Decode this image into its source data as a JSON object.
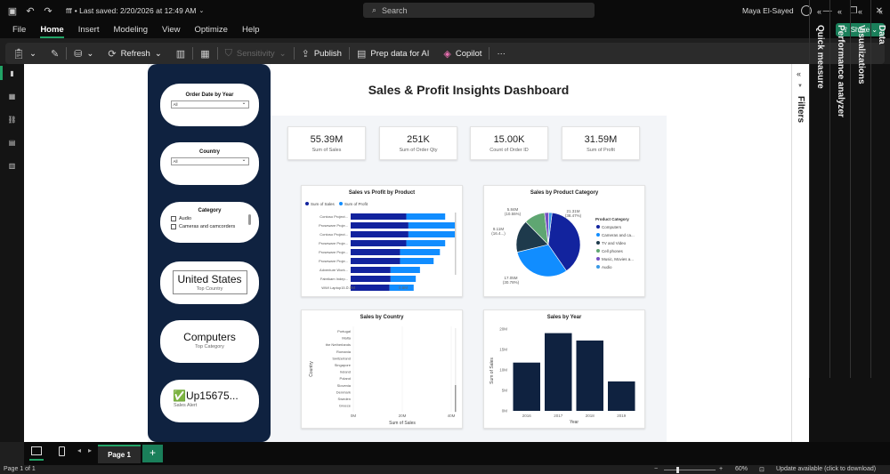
{
  "titlebar": {
    "file_name": "fff",
    "saved": "• Last saved: 2/20/2026 at 12:49 AM",
    "search": "Search",
    "user": "Maya El-Sayed"
  },
  "menu": [
    "File",
    "Home",
    "Insert",
    "Modeling",
    "View",
    "Optimize",
    "Help"
  ],
  "share_label": "Share",
  "ribbon": {
    "refresh": "Refresh",
    "sensitivity": "Sensitivity",
    "publish": "Publish",
    "prep": "Prep data for AI",
    "copilot": "Copilot",
    "more": "···"
  },
  "report": {
    "title": "Sales & Profit Insights Dashboard",
    "slicers": {
      "order_date": {
        "label": "Order Date by Year",
        "value": "All"
      },
      "country": {
        "label": "Country",
        "value": "All"
      },
      "category": {
        "label": "Category",
        "items": [
          "Audio",
          "Cameras and camcorders"
        ]
      }
    },
    "cards": [
      {
        "value": "United States",
        "label": "Top Country"
      },
      {
        "value": "Computers",
        "label": "Top Category"
      },
      {
        "value": "✅Up15675...",
        "label": "Sales Alert"
      }
    ],
    "kpis": [
      {
        "value": "55.39M",
        "label": "Sum of Sales"
      },
      {
        "value": "251K",
        "label": "Sum of Order Qty"
      },
      {
        "value": "15.00K",
        "label": "Count of Order ID"
      },
      {
        "value": "31.59M",
        "label": "Sum of Profit"
      }
    ]
  },
  "chart_data": [
    {
      "type": "bar",
      "title": "Sales vs Profit by Product",
      "orientation": "horizontal",
      "legend": "top-left",
      "categories": [
        "Contoso Project...",
        "Proseware Proje...",
        "Contoso Project...",
        "Proseware Proje...",
        "Proseware Proje...",
        "Proseware Proje...",
        "Adventure Work...",
        "Fabrikam Indep...",
        "WWI Laptop15..."
      ],
      "series": [
        {
          "name": "Sum of Sales",
          "values": [
            0.53,
            0.55,
            0.55,
            0.53,
            0.47,
            0.47,
            0.38,
            0.38,
            0.37
          ],
          "color": "#12239e"
        },
        {
          "name": "Sum of Profit",
          "values": [
            0.37,
            0.45,
            0.45,
            0.37,
            0.38,
            0.32,
            0.28,
            0.24,
            0.23
          ],
          "color": "#118dff"
        }
      ],
      "x_ticks": [
        "0.0M",
        "0.5M"
      ],
      "xlim": [
        0,
        1.0
      ]
    },
    {
      "type": "pie",
      "title": "Sales by Product Category",
      "legend_title": "Product Category",
      "legend": "right",
      "slices": [
        {
          "name": "Computers",
          "value": 21.31,
          "label": "21.31M (38.47%)",
          "color": "#12239e"
        },
        {
          "name": "Cameras and ca...",
          "value": 17.05,
          "label": "17.05M (30.78%)",
          "color": "#118dff"
        },
        {
          "name": "TV and Video",
          "value": 9.11,
          "label": "9.11M (16.4...)",
          "color": "#1e3a4c"
        },
        {
          "name": "Cell phones",
          "value": 5.84,
          "label": "5.84M (10.55%)",
          "color": "#5fa672"
        },
        {
          "name": "Music, Movies a...",
          "value": 1.2,
          "label": "",
          "color": "#744ec2"
        },
        {
          "name": "Audio",
          "value": 0.88,
          "label": "",
          "color": "#3899e6"
        }
      ]
    },
    {
      "type": "bar",
      "title": "Sales by Country",
      "orientation": "horizontal",
      "xlabel": "Sum of Sales",
      "ylabel": "Country",
      "categories": [
        "Portugal",
        "Malta",
        "the Netherlands",
        "Romania",
        "Switzerland",
        "Singapore",
        "Ireland",
        "Poland",
        "Slovenia",
        "Denmark",
        "Sweden",
        "Greece"
      ],
      "x_ticks": [
        "0M",
        "20M",
        "40M"
      ],
      "xlim": [
        0,
        40
      ]
    },
    {
      "type": "bar",
      "title": "Sales by Year",
      "xlabel": "Year",
      "ylabel": "Sum of Sales",
      "categories": [
        "2016",
        "2017",
        "2018",
        "2019"
      ],
      "values": [
        11.8,
        19.0,
        17.2,
        7.2
      ],
      "y_ticks": [
        "0M",
        "5M",
        "10M",
        "15M",
        "20M"
      ],
      "ylim": [
        0,
        20
      ],
      "color": "#0f2240"
    }
  ],
  "right_panes": [
    "Filters",
    "Quick measure",
    "Performance analyzer",
    "Visualizations",
    "Data"
  ],
  "page_tab": "Page 1",
  "status": {
    "page": "Page 1 of 1",
    "zoom": "60%",
    "update": "Update available (click to download)"
  }
}
